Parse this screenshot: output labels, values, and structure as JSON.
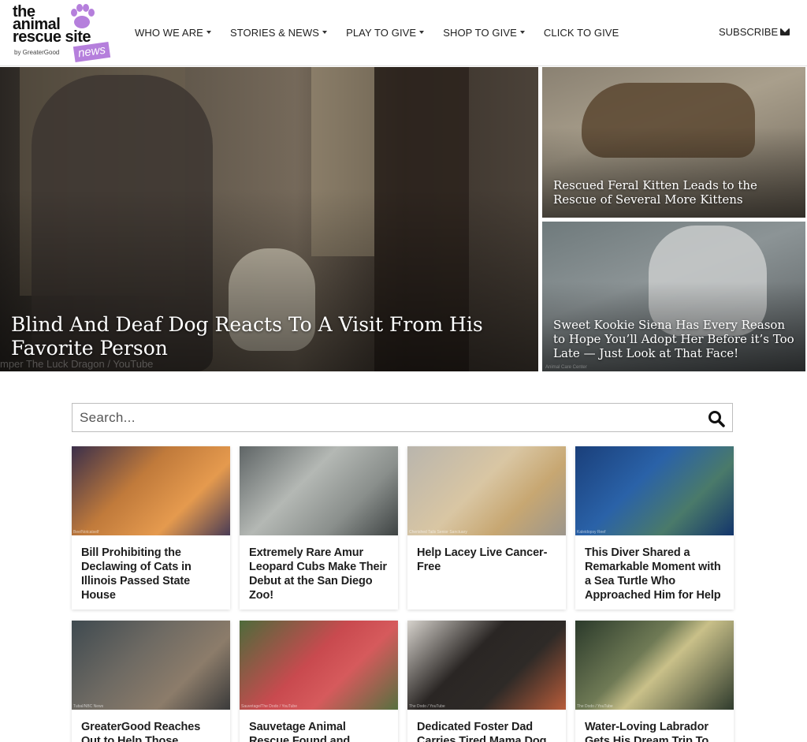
{
  "brand": {
    "line1": "the",
    "line2": "animal",
    "line3": "rescue site",
    "by": "by GreaterGood",
    "badge": "news"
  },
  "nav": {
    "items": [
      {
        "label": "WHO WE ARE",
        "has_dropdown": true
      },
      {
        "label": "STORIES & NEWS",
        "has_dropdown": true
      },
      {
        "label": "PLAY TO GIVE",
        "has_dropdown": true
      },
      {
        "label": "SHOP TO GIVE",
        "has_dropdown": true
      },
      {
        "label": "CLICK TO GIVE",
        "has_dropdown": false
      }
    ],
    "subscribe_label": "SUBSCRIBE",
    "subscribe_icon": "envelope-icon"
  },
  "hero": {
    "main": {
      "title": "Blind And Deaf Dog Reacts To A Visit From His Favorite Person",
      "credit": "mper The Luck Dragon / YouTube"
    },
    "side1": {
      "title": "Rescued Feral Kitten Leads to the Rescue of Several More Kittens"
    },
    "side2": {
      "title": "Sweet Kookie Siena Has Every Reason to Hope You’ll Adopt Her Before it’s Too Late — Just Look at That Face!",
      "credit": "Animal Care Center"
    }
  },
  "search": {
    "placeholder": "Search...",
    "value": "",
    "icon": "search-icon"
  },
  "cards": [
    {
      "title": "Bill Prohibiting the Declawing of Cats in Illinois Passed State House",
      "credit": "Bee/Notcatself"
    },
    {
      "title": "Extremely Rare Amur Leopard Cubs Make Their Debut at the San Diego Zoo!",
      "credit": ""
    },
    {
      "title": "Help Lacey Live Cancer-Free",
      "credit": "Cherished Tails Senior Sanctuary"
    },
    {
      "title": "This Diver Shared a Remarkable Moment with a Sea Turtle Who Approached Him for Help",
      "credit": "Kaleidopsy Reef"
    },
    {
      "title": "GreaterGood Reaches Out to Help Those Affected by",
      "credit": "Tubal/NBC News"
    },
    {
      "title": "Sauvetage Animal Rescue Found and Helped a",
      "credit": "Sauvetage/The Dodo / YouTube"
    },
    {
      "title": "Dedicated Foster Dad Carries Tired Mama Dog",
      "credit": "The Dodo / YouTube"
    },
    {
      "title": "Water-Loving Labrador Gets His Dream Trip To",
      "credit": "The Dodo / YouTube"
    }
  ],
  "colors": {
    "accent": "#b57fdc",
    "text": "#1e1e1e"
  }
}
